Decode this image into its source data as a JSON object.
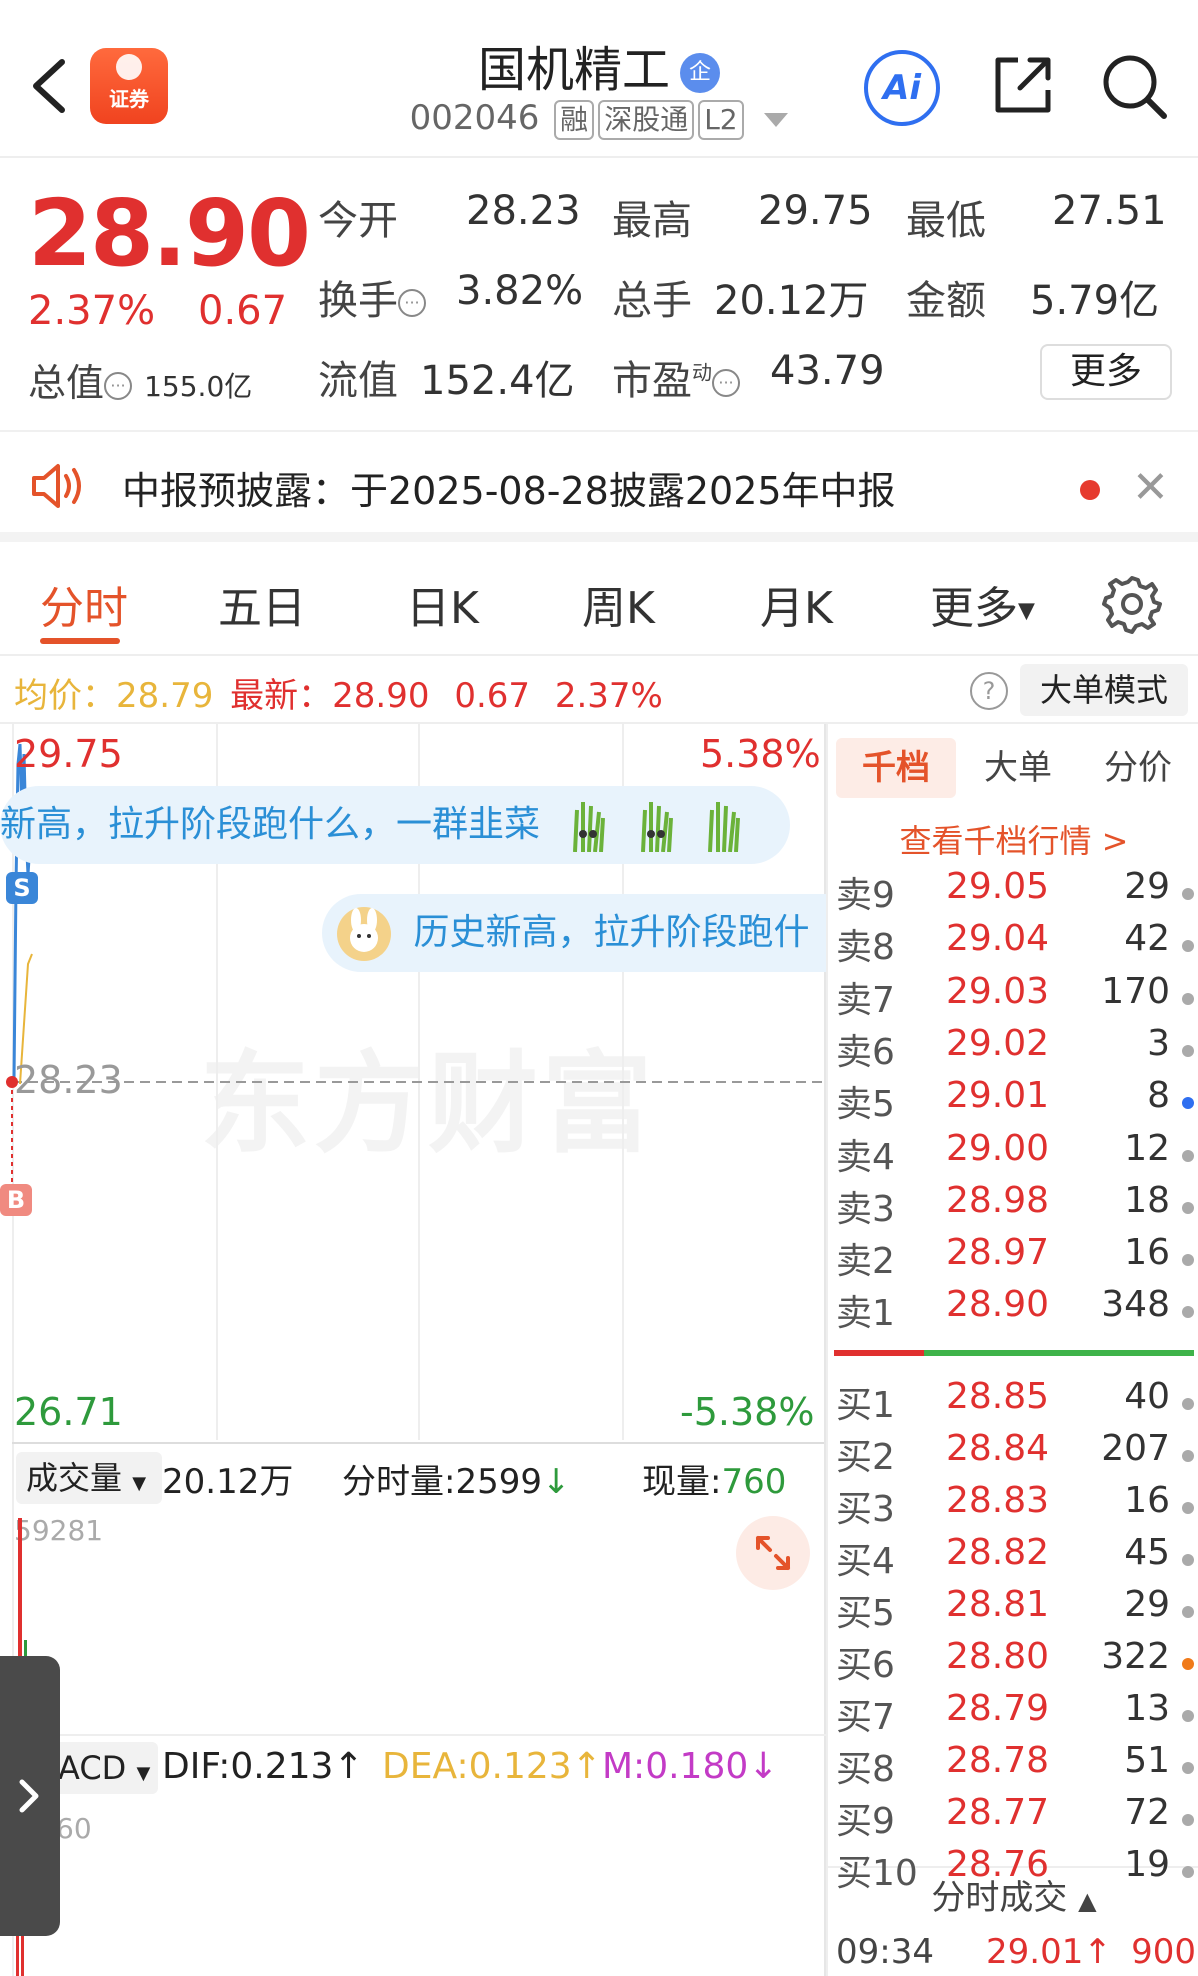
{
  "header": {
    "app_logo_text": "证券",
    "stock_name": "国机精工",
    "qi_badge": "企",
    "stock_code": "002046",
    "tags": [
      "融",
      "深股通",
      "L2"
    ],
    "ai_label": "Ai"
  },
  "quote": {
    "price": "28.90",
    "change_pct": "2.37%",
    "change": "0.67",
    "total_value_label": "总值",
    "total_value": "155.0亿",
    "fields": [
      {
        "label": "今开",
        "value": "28.23",
        "color": "#333333"
      },
      {
        "label": "最高",
        "value": "29.75",
        "color": "#e0302f"
      },
      {
        "label": "最低",
        "value": "27.51",
        "color": "#2e9a3c"
      },
      {
        "label": "换手",
        "value": "3.82%",
        "color": "#333333"
      },
      {
        "label": "总手",
        "value": "20.12万",
        "color": "#333333"
      },
      {
        "label": "金额",
        "value": "5.79亿",
        "color": "#333333"
      },
      {
        "label": "流值",
        "value": "152.4亿",
        "color": "#333333"
      },
      {
        "label": "市盈",
        "value": "43.79",
        "color": "#333333"
      }
    ],
    "pe_superscript": "动",
    "more_button": "更多"
  },
  "notice": {
    "text": "中报预披露：于2025-08-28披露2025年中报"
  },
  "tabs": {
    "items": [
      "分时",
      "五日",
      "日K",
      "周K",
      "月K",
      "更多"
    ],
    "active": "分时"
  },
  "avg_bar": {
    "avg_label": "均价：",
    "avg_value": "28.79",
    "latest_label": "最新：",
    "latest_value": "28.90",
    "latest_change": "0.67",
    "latest_pct": "2.37%",
    "help": "?",
    "big_order_mode": "大单模式"
  },
  "chart": {
    "high": "29.75",
    "high_pct": "5.38%",
    "mid": "28.23",
    "low": "26.71",
    "low_pct": "-5.38%",
    "watermark": "东方财富",
    "bubble1": "新高，拉升阶段跑什么，一群韭菜",
    "bubble2": "历史新高，拉升阶段跑什",
    "s_marker": "S",
    "b_marker": "B",
    "volume_select": "成交量",
    "volume_total": "20.12万",
    "minute_vol_label": "分时量:2599",
    "current_vol_label": "现量:",
    "current_vol": "760",
    "vol_max": "59281",
    "macd_select": "ACD",
    "dif": "DIF:0.213",
    "dea": "DEA:0.123",
    "m": "M:0.180",
    "macd_axis": "60",
    "colors": {
      "rise": "#e0302f",
      "fall": "#2e9a3c",
      "avg": "#e8b53b",
      "price": "#3a86d8",
      "macd_m": "#c33bc6"
    }
  },
  "order_book": {
    "tabs": [
      "千档",
      "大单",
      "分价"
    ],
    "active_tab": "千档",
    "view_thousand": "查看千档行情 >",
    "asks": [
      {
        "label": "卖9",
        "price": "29.05",
        "qty": "29",
        "dot": "#aaaaaa"
      },
      {
        "label": "卖8",
        "price": "29.04",
        "qty": "42",
        "dot": "#aaaaaa"
      },
      {
        "label": "卖7",
        "price": "29.03",
        "qty": "170",
        "dot": "#aaaaaa"
      },
      {
        "label": "卖6",
        "price": "29.02",
        "qty": "3",
        "dot": "#aaaaaa"
      },
      {
        "label": "卖5",
        "price": "29.01",
        "qty": "8",
        "dot": "#2f6ff0"
      },
      {
        "label": "卖4",
        "price": "29.00",
        "qty": "12",
        "dot": "#aaaaaa"
      },
      {
        "label": "卖3",
        "price": "28.98",
        "qty": "18",
        "dot": "#aaaaaa"
      },
      {
        "label": "卖2",
        "price": "28.97",
        "qty": "16",
        "dot": "#aaaaaa"
      },
      {
        "label": "卖1",
        "price": "28.90",
        "qty": "348",
        "dot": "#aaaaaa"
      }
    ],
    "bids": [
      {
        "label": "买1",
        "price": "28.85",
        "qty": "40",
        "dot": "#aaaaaa"
      },
      {
        "label": "买2",
        "price": "28.84",
        "qty": "207",
        "dot": "#aaaaaa"
      },
      {
        "label": "买3",
        "price": "28.83",
        "qty": "16",
        "dot": "#aaaaaa"
      },
      {
        "label": "买4",
        "price": "28.82",
        "qty": "45",
        "dot": "#aaaaaa"
      },
      {
        "label": "买5",
        "price": "28.81",
        "qty": "29",
        "dot": "#aaaaaa"
      },
      {
        "label": "买6",
        "price": "28.80",
        "qty": "322",
        "dot": "#f07a1a"
      },
      {
        "label": "买7",
        "price": "28.79",
        "qty": "13",
        "dot": "#aaaaaa"
      },
      {
        "label": "买8",
        "price": "28.78",
        "qty": "51",
        "dot": "#aaaaaa"
      },
      {
        "label": "买9",
        "price": "28.77",
        "qty": "72",
        "dot": "#aaaaaa"
      },
      {
        "label": "买10",
        "price": "28.76",
        "qty": "19",
        "dot": "#aaaaaa"
      }
    ],
    "trades_header": "分时成交",
    "trade": {
      "time": "09:34",
      "price": "29.01",
      "qty": "900"
    }
  }
}
